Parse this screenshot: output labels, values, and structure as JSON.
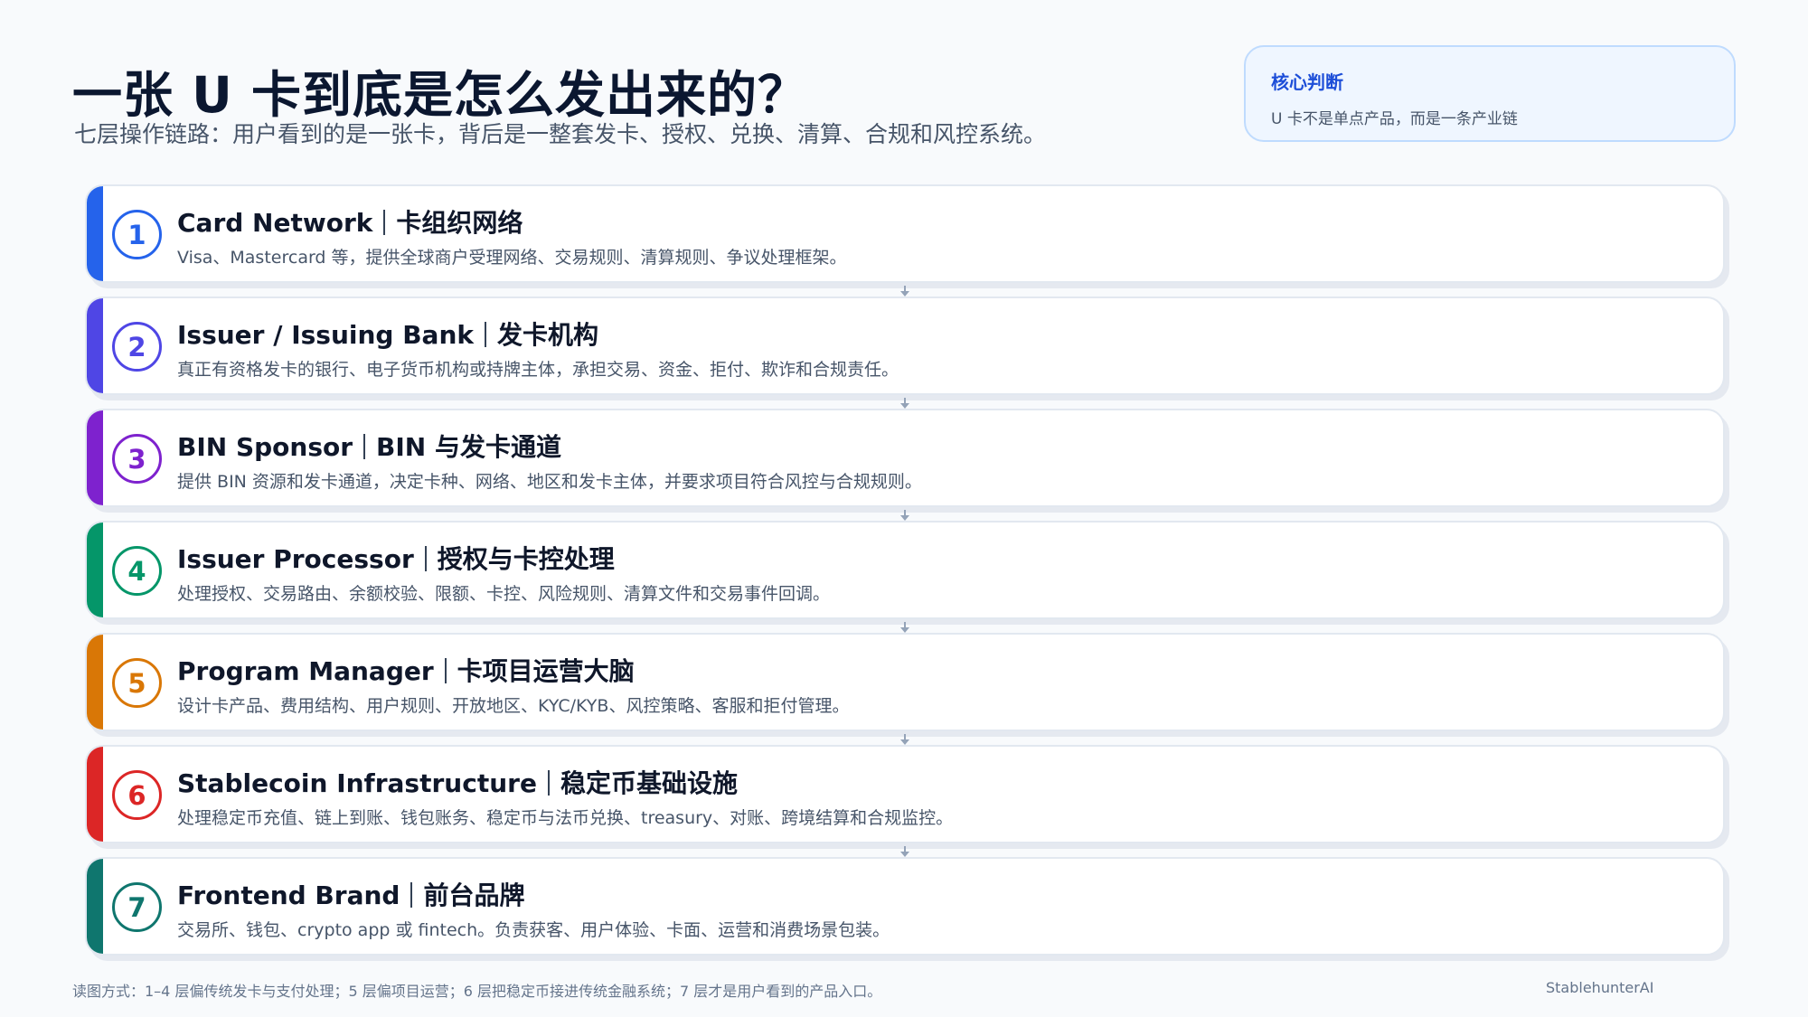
{
  "header": {
    "title": "一张 U 卡到底是怎么发出来的？",
    "subtitle": "七层操作链路：用户看到的是一张卡，背后是一整套发卡、授权、兑换、清算、合规和风控系统。"
  },
  "verdict": {
    "title": "核心判断",
    "text": "U 卡不是单点产品，而是一条产业链"
  },
  "layers": [
    {
      "num": "1",
      "en": "Card Network",
      "zh": "卡组织网络",
      "desc": "Visa、Mastercard 等，提供全球商户受理网络、交易规则、清算规则、争议处理框架。",
      "color": "#2563eb"
    },
    {
      "num": "2",
      "en": "Issuer / Issuing Bank",
      "zh": "发卡机构",
      "desc": "真正有资格发卡的银行、电子货币机构或持牌主体，承担交易、资金、拒付、欺诈和合规责任。",
      "color": "#4f46e5"
    },
    {
      "num": "3",
      "en": "BIN Sponsor",
      "zh": "BIN 与发卡通道",
      "desc": "提供 BIN 资源和发卡通道，决定卡种、网络、地区和发卡主体，并要求项目符合风控与合规规则。",
      "color": "#7e22ce"
    },
    {
      "num": "4",
      "en": "Issuer Processor",
      "zh": "授权与卡控处理",
      "desc": "处理授权、交易路由、余额校验、限额、卡控、风险规则、清算文件和交易事件回调。",
      "color": "#059669"
    },
    {
      "num": "5",
      "en": "Program Manager",
      "zh": "卡项目运营大脑",
      "desc": "设计卡产品、费用结构、用户规则、开放地区、KYC/KYB、风控策略、客服和拒付管理。",
      "color": "#d97706"
    },
    {
      "num": "6",
      "en": "Stablecoin Infrastructure",
      "zh": "稳定币基础设施",
      "desc": "处理稳定币充值、链上到账、钱包账务、稳定币与法币兑换、treasury、对账、跨境结算和合规监控。",
      "color": "#dc2626"
    },
    {
      "num": "7",
      "en": "Frontend Brand",
      "zh": "前台品牌",
      "desc": "交易所、钱包、crypto app 或 fintech。负责获客、用户体验、卡面、运营和消费场景包装。",
      "color": "#0f766e"
    }
  ],
  "footer": {
    "note": "读图方式：1–4 层偏传统发卡与支付处理；5 层偏项目运营；6 层把稳定币接进传统金融系统；7 层才是用户看到的产品入口。",
    "brand": "StablehunterAI"
  }
}
